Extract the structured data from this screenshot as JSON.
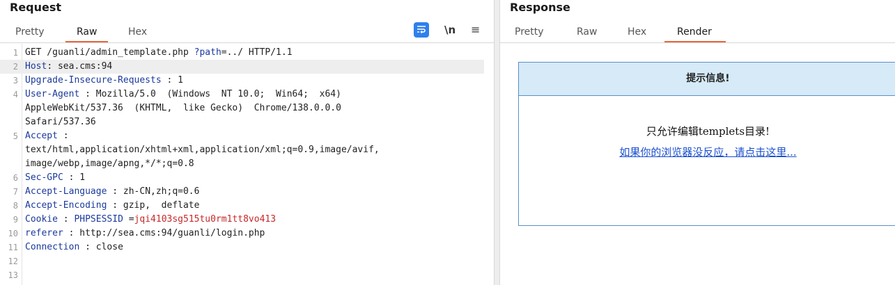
{
  "request": {
    "title": "Request",
    "tabs": [
      "Pretty",
      "Raw",
      "Hex"
    ],
    "active_tab": "Raw",
    "tools": {
      "wrap_icon": "word-wrap-icon",
      "newline_label": "\\n",
      "menu_icon": "hamburger-menu-icon"
    },
    "lines": [
      {
        "n": "1",
        "parts": [
          [
            "t",
            "GET /guanli/admin_template.php "
          ],
          [
            "p",
            "?path"
          ],
          [
            "t",
            "=../ HTTP/1.1"
          ]
        ]
      },
      {
        "n": "2",
        "parts": [
          [
            "k",
            "Host"
          ],
          [
            "t",
            ": sea.cms:94"
          ]
        ]
      },
      {
        "n": "3",
        "parts": [
          [
            "k",
            "Upgrade-Insecure-Requests"
          ],
          [
            "t",
            " : 1"
          ]
        ]
      },
      {
        "n": "4",
        "parts": [
          [
            "k",
            "User-Agent"
          ],
          [
            "t",
            " : Mozilla/5.0  (Windows  NT 10.0;  Win64;  x64)"
          ]
        ]
      },
      {
        "n": "",
        "parts": [
          [
            "t",
            "AppleWebKit/537.36  (KHTML,  like Gecko)  Chrome/138.0.0.0"
          ]
        ]
      },
      {
        "n": "",
        "parts": [
          [
            "t",
            "Safari/537.36"
          ]
        ]
      },
      {
        "n": "5",
        "parts": [
          [
            "k",
            "Accept"
          ],
          [
            "t",
            " :"
          ]
        ]
      },
      {
        "n": "",
        "parts": [
          [
            "t",
            "text/html,application/xhtml+xml,application/xml;q=0.9,image/avif,"
          ]
        ]
      },
      {
        "n": "",
        "parts": [
          [
            "t",
            "image/webp,image/apng,*/*;q=0.8"
          ]
        ]
      },
      {
        "n": "6",
        "parts": [
          [
            "k",
            "Sec-GPC"
          ],
          [
            "t",
            " : 1"
          ]
        ]
      },
      {
        "n": "7",
        "parts": [
          [
            "k",
            "Accept-Language"
          ],
          [
            "t",
            " : zh-CN,zh;q=0.6"
          ]
        ]
      },
      {
        "n": "8",
        "parts": [
          [
            "k",
            "Accept-Encoding"
          ],
          [
            "t",
            " : gzip,  deflate"
          ]
        ]
      },
      {
        "n": "9",
        "parts": [
          [
            "k",
            "Cookie"
          ],
          [
            "t",
            " : "
          ],
          [
            "p",
            "PHPSESSID"
          ],
          [
            "t",
            " ="
          ],
          [
            "r",
            "jqi4103sg515tu0rm1tt8vo413"
          ]
        ]
      },
      {
        "n": "10",
        "parts": [
          [
            "k",
            "referer"
          ],
          [
            "t",
            " : http://sea.cms:94/guanli/login.php"
          ]
        ]
      },
      {
        "n": "11",
        "parts": [
          [
            "k",
            "Connection"
          ],
          [
            "t",
            " : close"
          ]
        ]
      },
      {
        "n": "12",
        "parts": []
      },
      {
        "n": "13",
        "parts": []
      }
    ]
  },
  "response": {
    "title": "Response",
    "tabs": [
      "Pretty",
      "Raw",
      "Hex",
      "Render"
    ],
    "active_tab": "Render",
    "render": {
      "header": "提示信息!",
      "message": "只允许编辑templets目录!",
      "link": "如果你的浏览器没反应，请点击这里..."
    }
  },
  "colors": {
    "accent": "#e8663d",
    "header_key": "#1b3a9c",
    "cookie_value": "#c62828",
    "link": "#1a4fcf"
  }
}
